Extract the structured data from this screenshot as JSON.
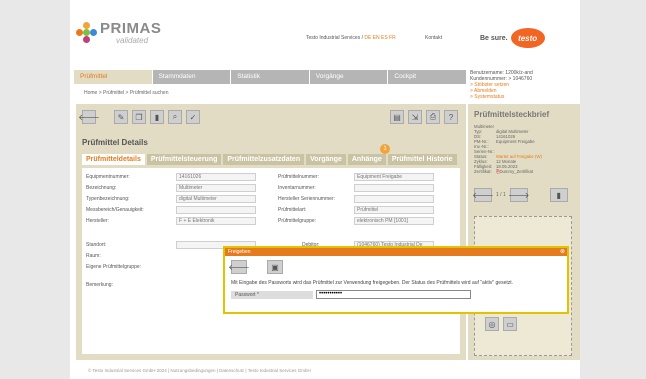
{
  "brand": {
    "name": "PRIMAS",
    "sub": "validated"
  },
  "topnav": {
    "services": "Testo Industrial Services",
    "langs": "DE EN ES FR",
    "contact": "Kontakt",
    "slogan": "Be sure.",
    "testo": "testo"
  },
  "mainnav": [
    "Prüfmittel",
    "Stammdaten",
    "Statistik",
    "Vorgänge",
    "Cockpit"
  ],
  "user": {
    "line1": "Benutzername: 1200k/z-and",
    "line2": "Kundennummer: > 1046760",
    "line3": "> Stöbster setzen",
    "line4": "> Abmelden",
    "line5": "> Systemstatus"
  },
  "breadcrumb": "Home > Prüfmittel > Prüfmittel suchen",
  "content": {
    "title": "Prüfmittel Details",
    "tabs": [
      "Prüfmitteldetails",
      "Prüfmittelsteuerung",
      "Prüfmittelzusatzdaten",
      "Vorgänge",
      "Anhänge",
      "Prüfmittel Historie"
    ],
    "badge": "1",
    "fields": {
      "equip_label": "Equipmentnummer:",
      "equip_value": "14161026",
      "bez_label": "Bezeichnung:",
      "bez_value": "Multimeter",
      "typ_label": "Typenbezeichnung:",
      "typ_value": "digital Multimeter",
      "mess_label": "Messbereich/Genauigkeit:",
      "herst_label": "Hersteller:",
      "herst_value": "F + E Elektronik",
      "pm_label": "Prüfmittelnummer:",
      "pm_value": "Equipment Freigabe",
      "inv_label": "Inventarnummer:",
      "hsn_label": "Hersteller Seriennummer:",
      "status_label": "Prüfmittelart:",
      "status_value": "Prüfmittel",
      "gruppe_label": "Prüfmittelgruppe:",
      "gruppe_value": "elektronisch PM [1001]",
      "standort_label": "Standort:",
      "raum_label": "Raum:",
      "eigene_label": "Eigene Prüfmittelgruppe:",
      "debitor_label": "Debitor:",
      "debitor_value": "(1046760) Testo Industrial De",
      "bem_label": "Bemerkung:"
    }
  },
  "dialog": {
    "title": "Freigeben",
    "close": "⊗",
    "message": "Mit Eingabe des Passworts wird das Prüfmittel zur Verwendung freigegeben. Der Status des Prüfmittels wird auf \"aktiv\" gesetzt.",
    "pw_label": "Passwort *",
    "pw_value": "•••••••••••"
  },
  "side": {
    "title": "Prüfmittelsteckbrief",
    "rows": [
      {
        "k": "Multimeter",
        "v": ""
      },
      {
        "k": "Typ:",
        "v": "digital Multimeter"
      },
      {
        "k": "DS:",
        "v": "14161026"
      },
      {
        "k": "PM-Nr.:",
        "v": "Equipment Freigabe"
      },
      {
        "k": "Inv.-Nr.:",
        "v": ""
      },
      {
        "k": "Serien-Nr.:",
        "v": ""
      },
      {
        "k": "Status:",
        "v": "Wartet auf Freigabe (W)"
      },
      {
        "k": "Zyklus:",
        "v": "12 Monate"
      },
      {
        "k": "Fälligkeit:",
        "v": "18.05.2023"
      },
      {
        "k": "Zertifikat:",
        "v": "Dummy_Zertifikat"
      }
    ],
    "pager": "1 / 1"
  },
  "footer": "© Testo Industrial Services GmbH 2024 | Nutzungsbedingungen | Datenschutz | Testo Industrial Services GmbH",
  "colors": {
    "accent": "#e67b1e",
    "panel": "#e1dcc3",
    "dialog_border": "#e0c400"
  }
}
